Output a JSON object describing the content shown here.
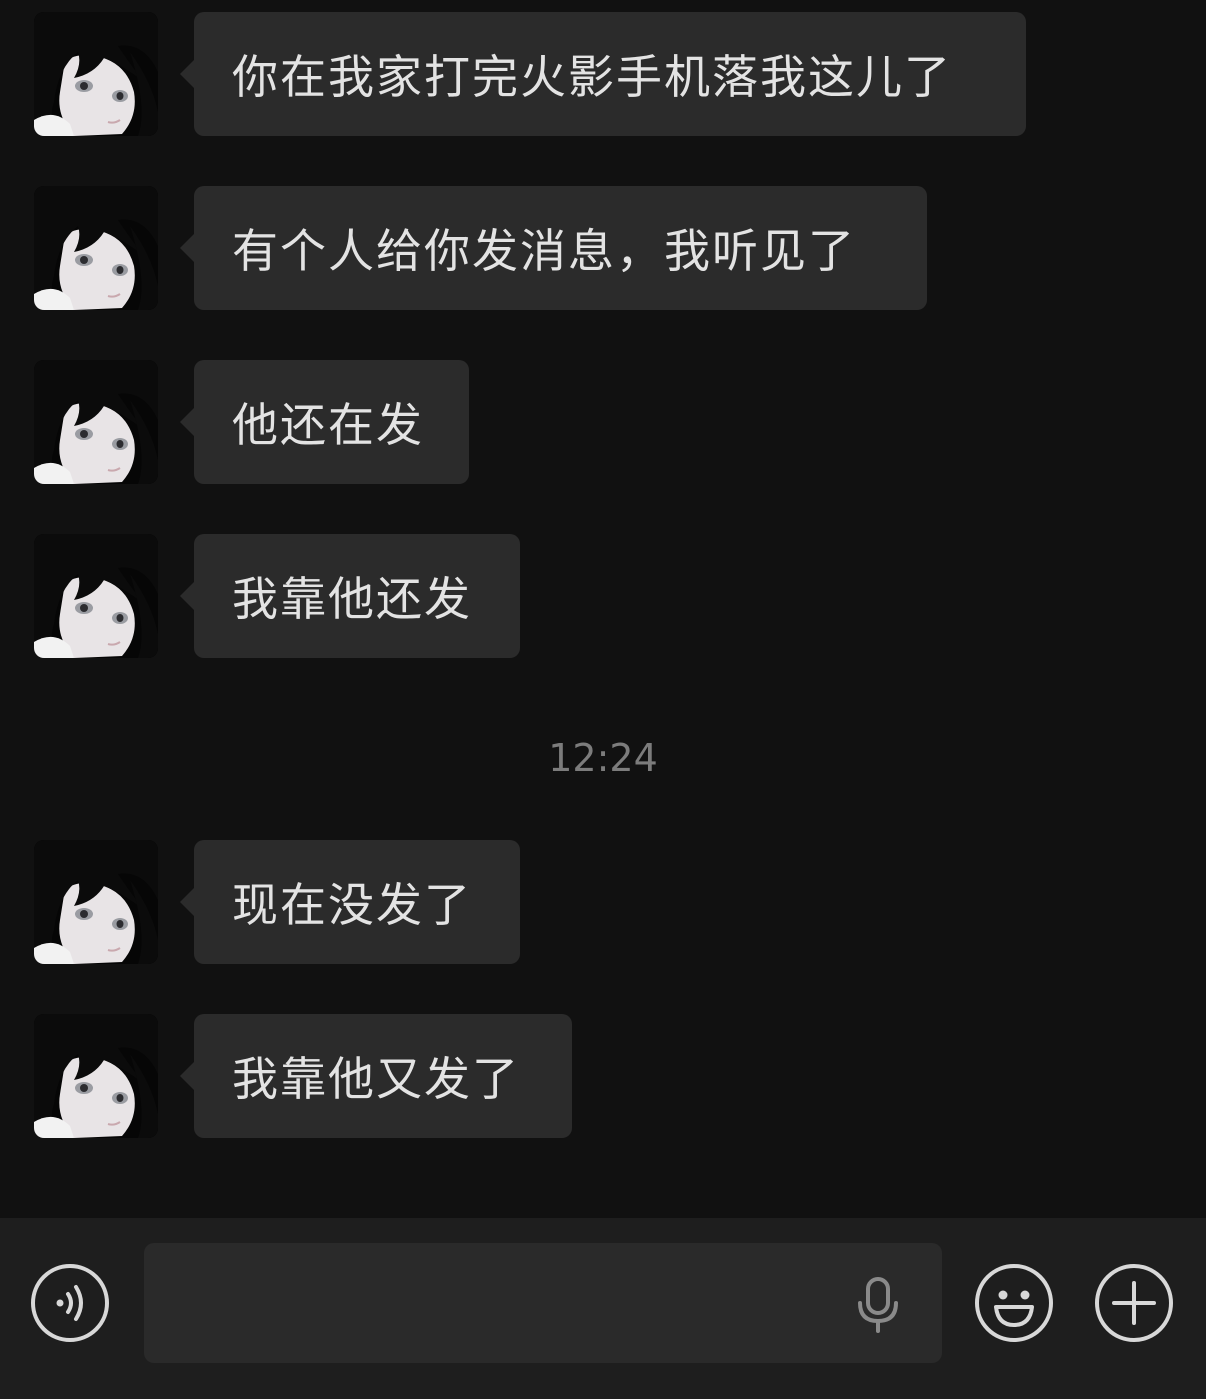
{
  "messages": [
    {
      "text": "你在我家打完火影手机落我这儿了"
    },
    {
      "text": "有个人给你发消息，我听见了"
    },
    {
      "text": "他还在发"
    },
    {
      "text": "我靠他还发"
    },
    {
      "text": "现在没发了"
    },
    {
      "text": "我靠他又发了"
    }
  ],
  "timestamp": "12:24",
  "input_bar": {
    "voice_toggle_icon": "voice-icon",
    "mic_icon": "mic-icon",
    "emoji_icon": "emoji-icon",
    "plus_icon": "plus-icon",
    "text_value": ""
  },
  "colors": {
    "background": "#111111",
    "bubble": "#2b2b2b",
    "bubble_text": "#e3e3e3",
    "timestamp": "#7c7c7c",
    "input_bar": "#1e1e1e"
  }
}
